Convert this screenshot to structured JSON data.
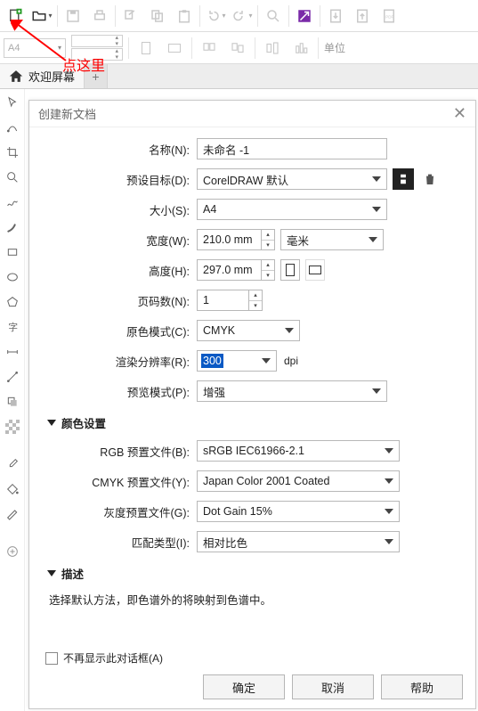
{
  "annotation": {
    "text": "点这里"
  },
  "paper": {
    "value": "A4"
  },
  "unit_row_label": "单位",
  "tab": {
    "welcome": "欢迎屏幕"
  },
  "dialog": {
    "title": "创建新文档",
    "labels": {
      "name": "名称(N):",
      "preset": "预设目标(D):",
      "size": "大小(S):",
      "width": "宽度(W):",
      "height": "高度(H):",
      "pages": "页码数(N):",
      "colormode": "原色模式(C):",
      "render_res": "渲染分辨率(R):",
      "preview": "预览模式(P):",
      "rgb_profile": "RGB 预置文件(B):",
      "cmyk_profile": "CMYK 预置文件(Y):",
      "gray_profile": "灰度预置文件(G):",
      "match_type": "匹配类型(I):"
    },
    "values": {
      "name": "未命名 -1",
      "preset": "CorelDRAW 默认",
      "size": "A4",
      "width": "210.0 mm",
      "height": "297.0 mm",
      "unit": "毫米",
      "pages": "1",
      "colormode": "CMYK",
      "render_res": "300",
      "dpi": "dpi",
      "preview": "增强",
      "rgb_profile": "sRGB IEC61966-2.1",
      "cmyk_profile": "Japan Color 2001 Coated",
      "gray_profile": "Dot Gain 15%",
      "match_type": "相对比色"
    },
    "sections": {
      "color": "颜色设置",
      "desc": "描述"
    },
    "desc_text": "选择默认方法，即色谱外的将映射到色谱中。",
    "checkbox": "不再显示此对话框(A)",
    "buttons": {
      "ok": "确定",
      "cancel": "取消",
      "help": "帮助"
    }
  }
}
